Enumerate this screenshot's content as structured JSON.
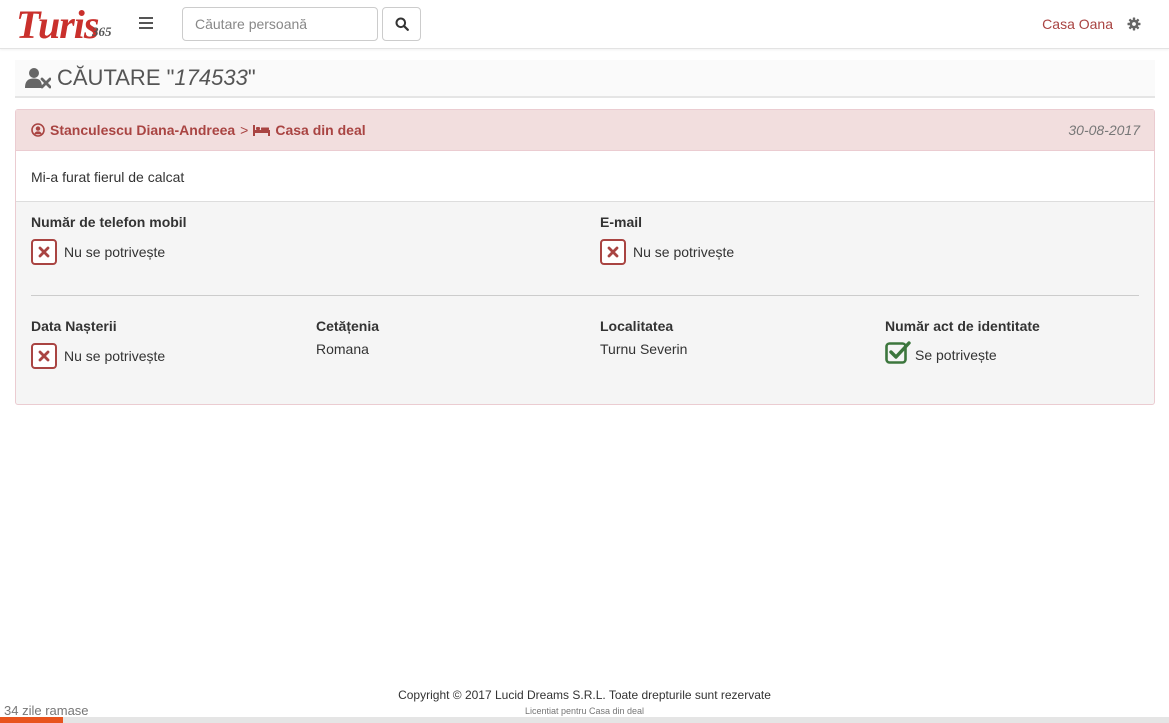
{
  "header": {
    "logo_text": "Turis",
    "logo_number": "365",
    "search_placeholder": "Căutare persoană",
    "house_name": "Casa Oana"
  },
  "page": {
    "title_prefix": "CĂUTARE \"",
    "title_query": "174533",
    "title_suffix": "\""
  },
  "result": {
    "person_name": "Stanculescu Diana-Andreea",
    "separator": ">",
    "property_name": "Casa din deal",
    "date": "30-08-2017",
    "message": "Mi-a furat fierul de calcat",
    "fields": {
      "phone": {
        "label": "Număr de telefon mobil",
        "status": "Nu se potrivește"
      },
      "email": {
        "label": "E-mail",
        "status": "Nu se potrivește"
      },
      "birth_date": {
        "label": "Data Nașterii",
        "status": "Nu se potrivește"
      },
      "citizenship": {
        "label": "Cetățenia",
        "value": "Romana"
      },
      "locality": {
        "label": "Localitatea",
        "value": "Turnu Severin"
      },
      "id_number": {
        "label": "Număr act de identitate",
        "status": "Se potrivește"
      }
    }
  },
  "footer": {
    "copyright": "Copyright © 2017 Lucid Dreams S.R.L. Toate drepturile sunt rezervate",
    "license": "Licentiat pentru Casa din deal",
    "days_left": "34 zile ramase",
    "trial_progress": 0.054
  },
  "colors": {
    "brand": "#c9302c",
    "danger": "#a94442",
    "success": "#3c763d",
    "progress": "#e8541e"
  },
  "icons": [
    "menu-icon",
    "search-icon",
    "gear-icon",
    "user-times-icon",
    "user-circle-icon",
    "bed-icon",
    "times-icon",
    "check-square-icon"
  ]
}
